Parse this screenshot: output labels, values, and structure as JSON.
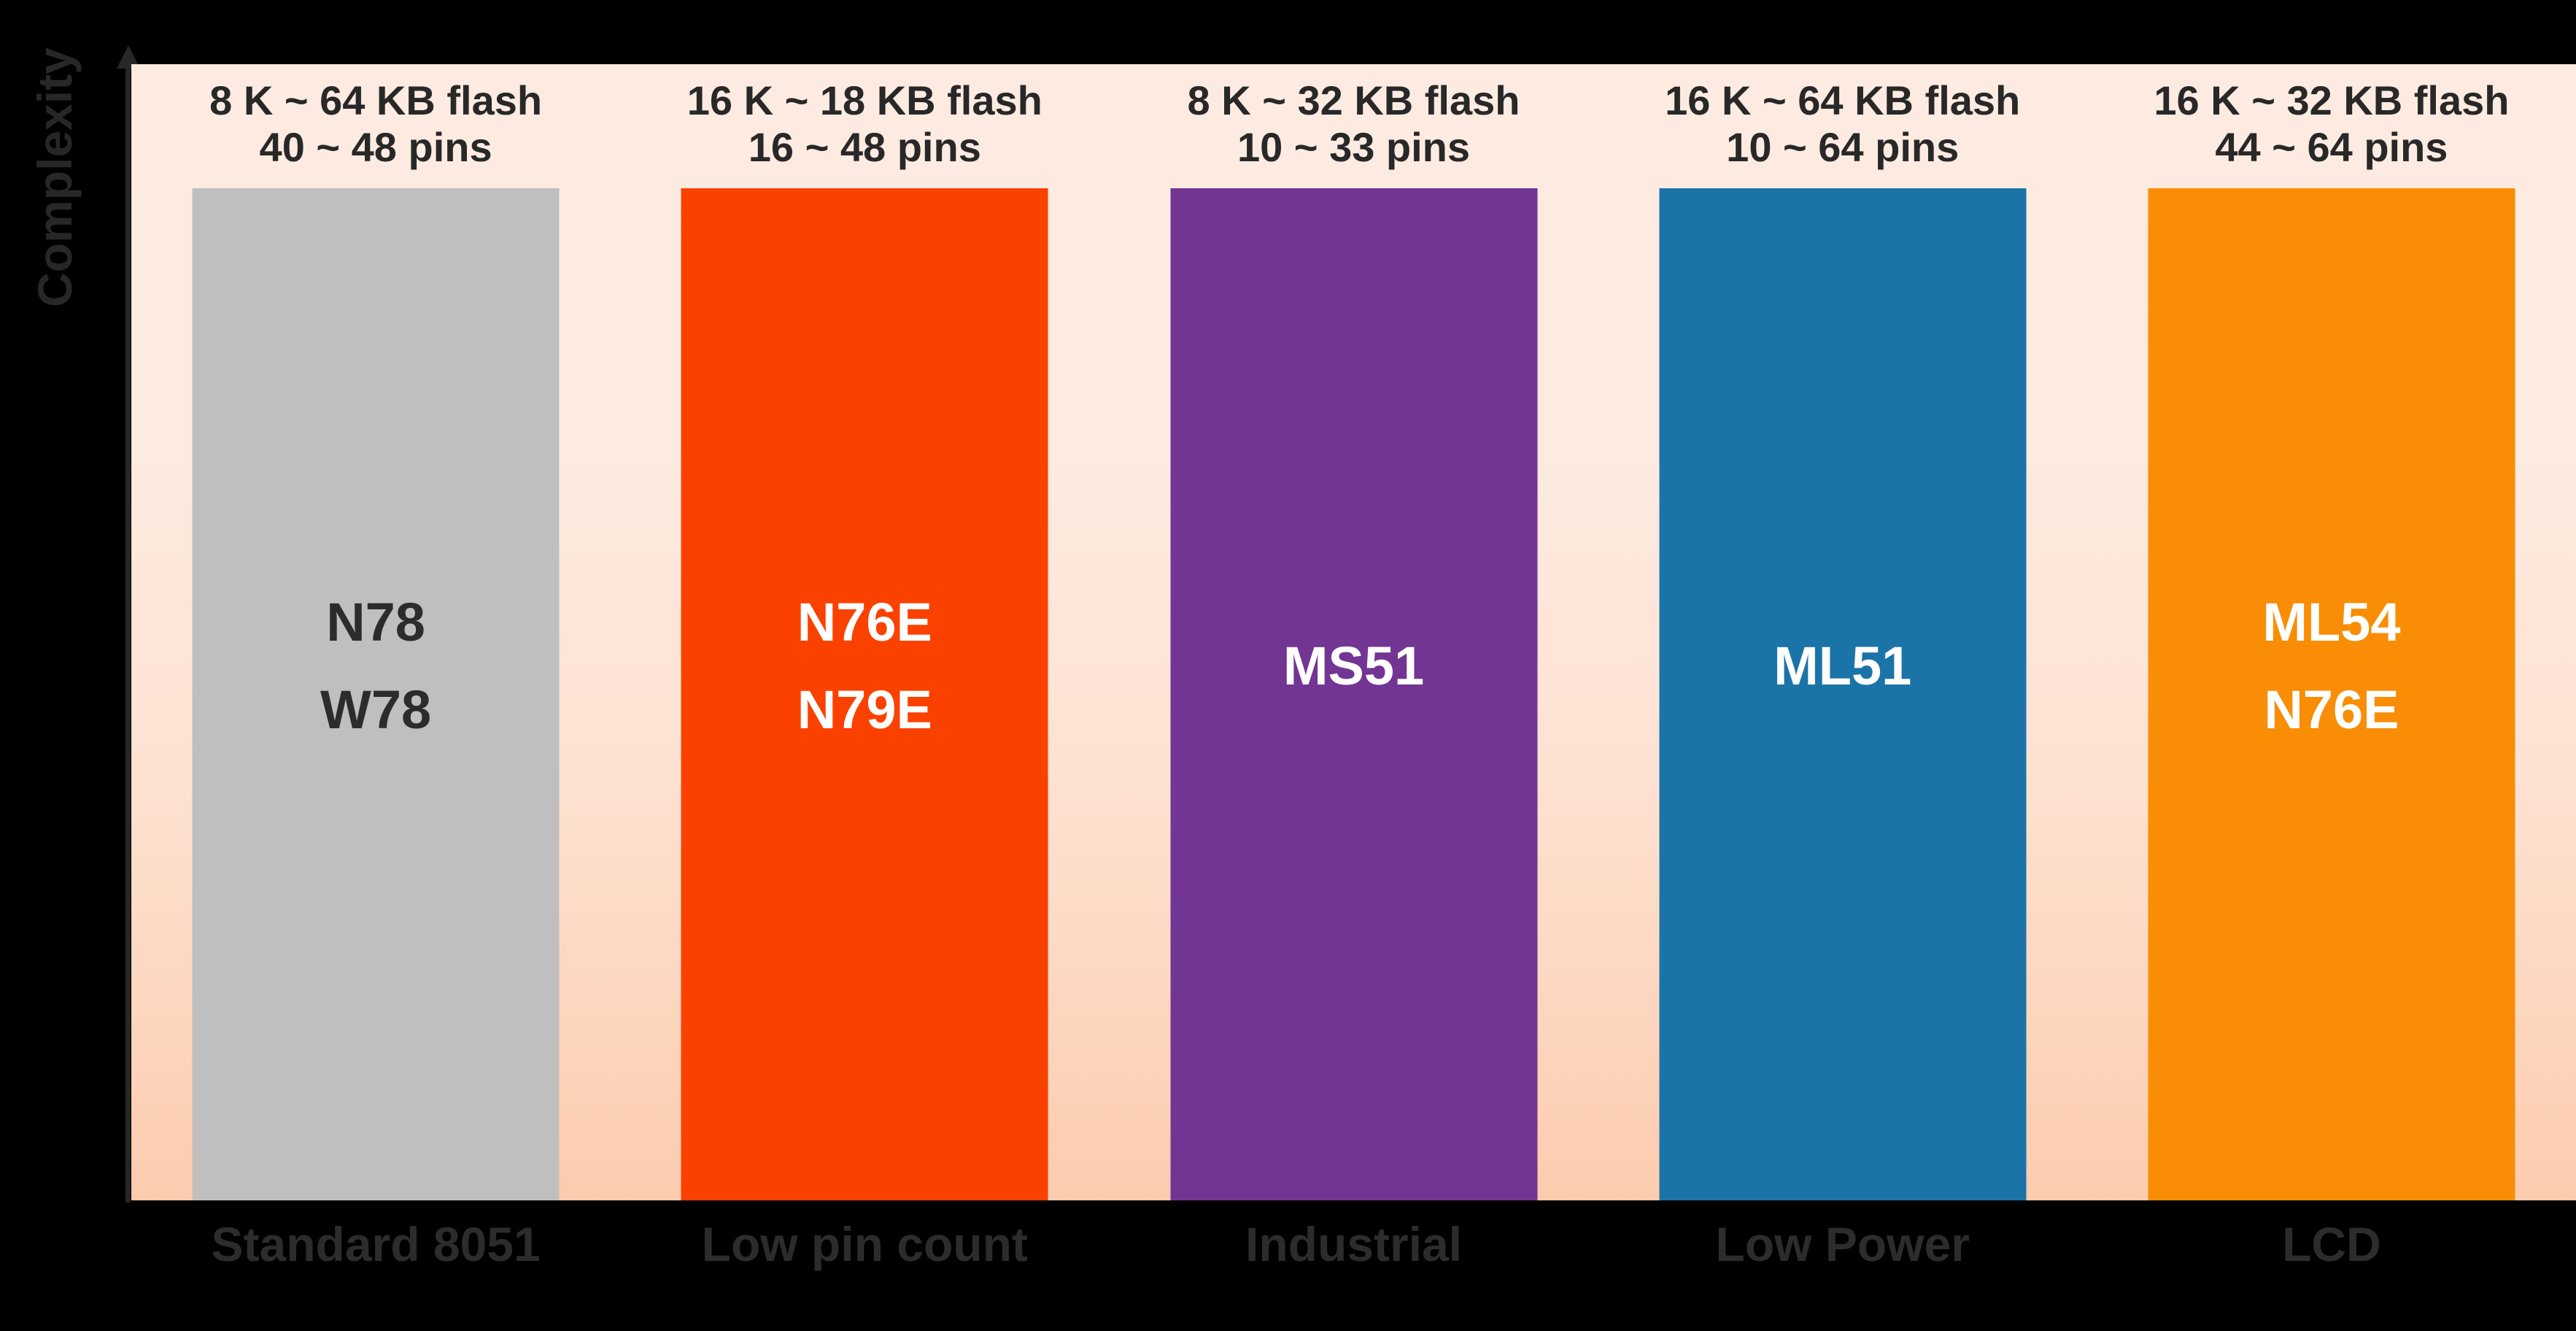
{
  "axis": {
    "y_label": "Complexity"
  },
  "chart_data": {
    "type": "bar",
    "title": "",
    "xlabel": "",
    "ylabel": "Complexity",
    "grid": false,
    "legend": "none",
    "categories": [
      "Standard 8051",
      "Low pin count",
      "Industrial",
      "Low Power",
      "LCD"
    ],
    "series": [
      {
        "name": "Complexity",
        "values": [
          1,
          1,
          1,
          1,
          1
        ]
      }
    ],
    "annotations": [
      "8 K ~ 64 KB flash / 40 ~ 48 pins",
      "16 K ~ 18 KB flash / 16 ~ 48 pins",
      "8 K ~ 32 KB flash / 10 ~ 33 pins",
      "16 K ~ 64 KB flash / 10 ~ 64 pins",
      "16 K ~ 32 KB flash / 44 ~ 64 pins"
    ],
    "bars": [
      {
        "category": "Standard 8051",
        "flash": "8 K ~ 64 KB flash",
        "pins": "40 ~ 48 pins",
        "parts": [
          "N78",
          "W78"
        ],
        "color": "#BFBFBF",
        "text_color": "#2c2c2c"
      },
      {
        "category": "Low pin count",
        "flash": "16 K ~ 18 KB flash",
        "pins": "16 ~ 48 pins",
        "parts": [
          "N76E",
          "N79E"
        ],
        "color": "#FB4100",
        "text_color": "#FFFFFF"
      },
      {
        "category": "Industrial",
        "flash": "8 K ~ 32 KB flash",
        "pins": "10 ~ 33 pins",
        "parts": [
          "MS51"
        ],
        "color": "#733594",
        "text_color": "#FFFFFF"
      },
      {
        "category": "Low Power",
        "flash": "16 K ~ 64 KB flash",
        "pins": "10 ~ 64 pins",
        "parts": [
          "ML51"
        ],
        "color": "#1B74A8",
        "text_color": "#FFFFFF"
      },
      {
        "category": "LCD",
        "flash": "16 K ~ 32 KB flash",
        "pins": "44 ~ 64 pins",
        "parts": [
          "ML54",
          "N76E"
        ],
        "color": "#F98D05",
        "text_color": "#FFFFFF"
      }
    ]
  },
  "palette": {
    "page_background": "#000000",
    "plot_gradient_top": "#FDEBE1",
    "plot_gradient_bottom": "#FCCBAE",
    "axis_color": "#272727",
    "header_text": "#282828",
    "category_text": "#2c2c2c"
  }
}
